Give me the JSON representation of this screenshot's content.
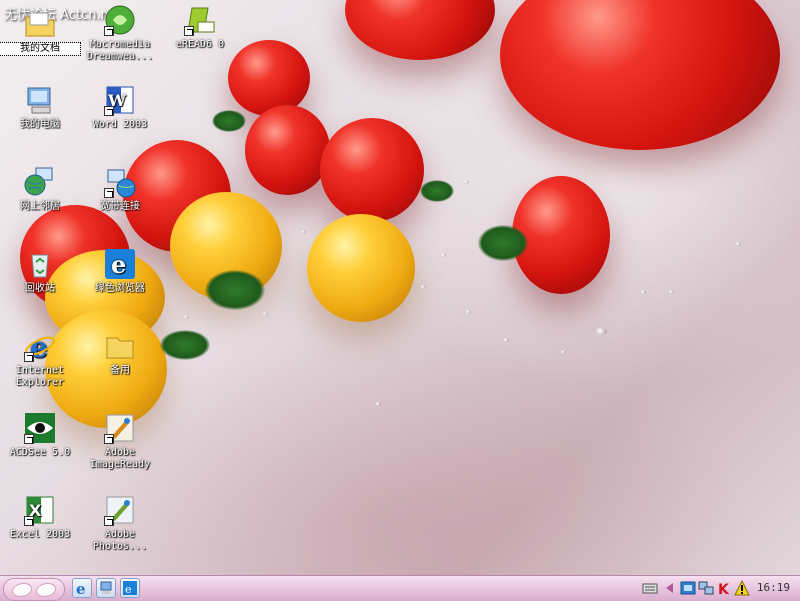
{
  "watermark": "无忧论坛 Actcn.net",
  "desktop_icons": [
    {
      "id": "my-documents",
      "label": "我的文档",
      "icon": "folder-documents-icon"
    },
    {
      "id": "macromedia-dreamweaver",
      "label": "Macromedia\nDreamwea...",
      "icon": "dreamweaver-icon"
    },
    {
      "id": "eread",
      "label": "eREAD6 0",
      "icon": "eread-icon"
    },
    {
      "id": "my-computer",
      "label": "我的电脑",
      "icon": "computer-icon"
    },
    {
      "id": "word-2003",
      "label": "Word 2003",
      "icon": "word-icon"
    },
    {
      "id": "network-places",
      "label": "网上邻居",
      "icon": "network-globe-icon"
    },
    {
      "id": "broadband",
      "label": "宽带连接",
      "icon": "broadband-connection-icon"
    },
    {
      "id": "recycle-bin",
      "label": "回收站",
      "icon": "recycle-bin-icon"
    },
    {
      "id": "green-browser",
      "label": "绿色浏览器",
      "icon": "browser-e-icon"
    },
    {
      "id": "internet-explorer",
      "label": "Internet\nExplorer",
      "icon": "internet-explorer-icon"
    },
    {
      "id": "backup-folder",
      "label": "备用",
      "icon": "folder-icon"
    },
    {
      "id": "acdsee",
      "label": "ACDSee 5.0",
      "icon": "acdsee-eye-icon"
    },
    {
      "id": "imageready",
      "label": "Adobe\nImageReady",
      "icon": "imageready-icon"
    },
    {
      "id": "excel-2003",
      "label": "Excel 2003",
      "icon": "excel-icon"
    },
    {
      "id": "photoshop",
      "label": "Adobe\nPhotos...",
      "icon": "photoshop-icon"
    }
  ],
  "taskbar": {
    "start_icon": "wings-logo-icon",
    "quick_launch": [
      "internet-explorer-icon",
      "computer-icon",
      "browser-icon"
    ],
    "tray": [
      "keyboard-icon",
      "arrow-icon",
      "network-icon",
      "monitor-icon",
      "antivirus-k-icon",
      "warning-icon"
    ],
    "clock": "16:19"
  },
  "colors": {
    "taskbar": "#e8c6df",
    "text": "#ffffff",
    "tomato_red": "#d5140f",
    "tomato_yellow": "#f0aa12"
  }
}
